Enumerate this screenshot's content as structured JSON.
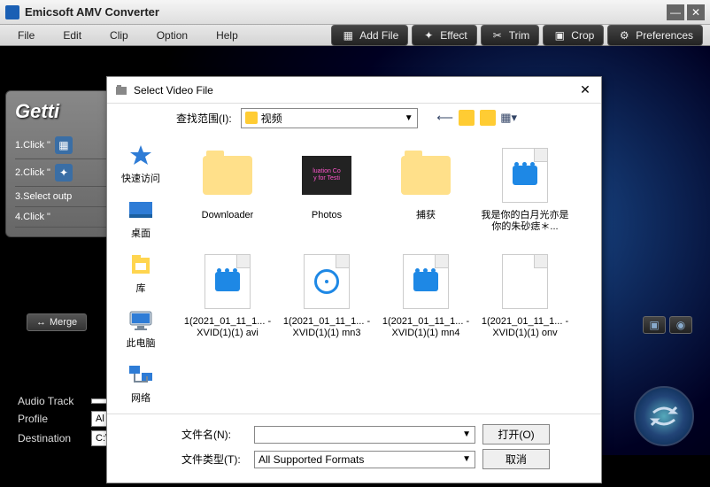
{
  "window": {
    "title": "Emicsoft AMV Converter",
    "menu": [
      "File",
      "Edit",
      "Clip",
      "Option",
      "Help"
    ],
    "toolbar": [
      {
        "icon": "add-file-icon",
        "label": "Add File"
      },
      {
        "icon": "effect-icon",
        "label": "Effect"
      },
      {
        "icon": "trim-icon",
        "label": "Trim"
      },
      {
        "icon": "crop-icon",
        "label": "Crop"
      },
      {
        "icon": "preferences-icon",
        "label": "Preferences"
      }
    ]
  },
  "steps": {
    "heading": "Getti",
    "s1": "1.Click \"",
    "s2": "2.Click \"",
    "s3": "3.Select outp",
    "s4": "4.Click \""
  },
  "merge": {
    "label": "Merge"
  },
  "form": {
    "audio_label": "Audio Track",
    "profile_label": "Profile",
    "profile_value": "Al",
    "dest_label": "Destination",
    "dest_value": "C:\\"
  },
  "dialog": {
    "title": "Select Video File",
    "lookin_label": "查找范围(I):",
    "lookin_value": "视频",
    "sidebar": [
      {
        "icon": "quickaccess-icon",
        "label": "快速访问"
      },
      {
        "icon": "desktop-icon",
        "label": "桌面"
      },
      {
        "icon": "libraries-icon",
        "label": "库"
      },
      {
        "icon": "thispc-icon",
        "label": "此电脑"
      },
      {
        "icon": "network-icon",
        "label": "网络"
      }
    ],
    "files": [
      {
        "type": "folder",
        "name": "Downloader"
      },
      {
        "type": "photos",
        "name": "Photos"
      },
      {
        "type": "folder",
        "name": "捕获"
      },
      {
        "type": "video-doc",
        "name": "我是你的白月光亦是你的朱砂痣＊..."
      },
      {
        "type": "video",
        "name": "1(2021_01_11_1... - XVID(1)(1) avi"
      },
      {
        "type": "disc",
        "name": "1(2021_01_11_1... - XVID(1)(1) mn3"
      },
      {
        "type": "video",
        "name": "1(2021_01_11_1... - XVID(1)(1) mn4"
      },
      {
        "type": "blank",
        "name": "1(2021_01_11_1... - XVID(1)(1) onv"
      }
    ],
    "filename_label": "文件名(N):",
    "filename_value": "",
    "filetype_label": "文件类型(T):",
    "filetype_value": "All Supported Formats",
    "open_label": "打开(O)",
    "cancel_label": "取消"
  }
}
